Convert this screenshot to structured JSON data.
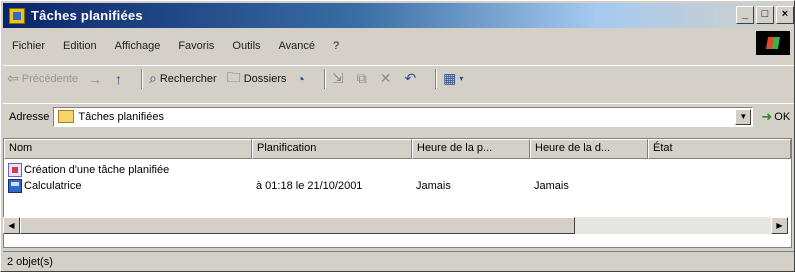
{
  "window": {
    "title": "Tâches planifiées",
    "buttons": {
      "minimize": "_",
      "maximize": "□",
      "close": "×"
    }
  },
  "menu": [
    "Fichier",
    "Edition",
    "Affichage",
    "Favoris",
    "Outils",
    "Avancé",
    "?"
  ],
  "toolbar": {
    "back": "Précédente",
    "forward": "→",
    "up": "↑",
    "search": "Rechercher",
    "folders": "Dossiers",
    "icons": {
      "back": "back-arrow-icon",
      "search": "search-icon",
      "folders": "folders-icon",
      "history": "history-icon",
      "move": "move-to-icon",
      "copy": "copy-to-icon",
      "delete": "delete-icon",
      "undo": "undo-icon",
      "views": "views-icon"
    }
  },
  "address": {
    "label": "Adresse",
    "value": "Tâches planifiées",
    "go": "OK"
  },
  "list": {
    "columns": [
      "Nom",
      "Planification",
      "Heure de la p...",
      "Heure de la d...",
      "État"
    ],
    "rows": [
      {
        "name": "Création d'une tâche planifiée",
        "schedule": "",
        "next": "",
        "last": "",
        "status": "",
        "icon": "add-task-icon"
      },
      {
        "name": "Calculatrice",
        "schedule": "à 01:18 le 21/10/2001",
        "next": "Jamais",
        "last": "Jamais",
        "status": "",
        "icon": "calculator-icon"
      }
    ]
  },
  "status": {
    "text": "2 objet(s)"
  }
}
